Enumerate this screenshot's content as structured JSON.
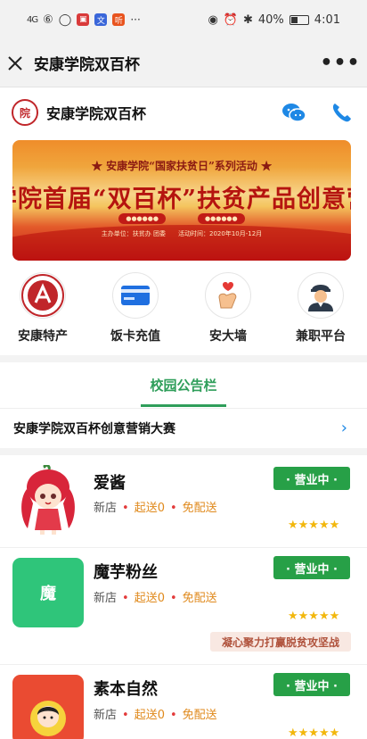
{
  "status_bar": {
    "signal": "4G",
    "battery": "40%",
    "time": "4:01"
  },
  "title_bar": {
    "title": "安康学院双百杯",
    "more": "•••"
  },
  "shop_header": {
    "logo_text": "院",
    "name": "安康学院双百杯"
  },
  "banner": {
    "subtitle": "★ 安康学院“国家扶贫日”系列活动 ★",
    "headline": "学院首届“双百杯”扶贫产品创意营销",
    "pills": [
      "●●●●●●",
      "●●●●●●"
    ],
    "footer": "主办单位：扶贫办 团委　　活动时间：2020年10月-12月"
  },
  "quick_menu": [
    {
      "label": "安康特产",
      "icon": "school-logo-icon"
    },
    {
      "label": "饭卡充值",
      "icon": "card-icon"
    },
    {
      "label": "安大墙",
      "icon": "heart-hand-icon"
    },
    {
      "label": "兼职平台",
      "icon": "worker-icon"
    }
  ],
  "notice": {
    "tab": "校园公告栏",
    "text": "安康学院双百杯创意营销大赛"
  },
  "shops": [
    {
      "name": "爱酱",
      "tag_new": "新店",
      "tag_min": "起送0",
      "tag_fee": "免配送",
      "status": "· 营业中 ·",
      "rating": 5
    },
    {
      "name": "魔芋粉丝",
      "thumb_text": "魔",
      "tag_new": "新店",
      "tag_min": "起送0",
      "tag_fee": "免配送",
      "status": "· 营业中 ·",
      "rating": 5,
      "slogan": "凝心聚力打赢脱贫攻坚战"
    },
    {
      "name": "素本自然",
      "tag_new": "新店",
      "tag_min": "起送0",
      "tag_fee": "免配送",
      "status": "· 营业中 ·",
      "rating": 5
    }
  ],
  "colors": {
    "accent_green": "#27a047",
    "notice_green": "#2f9e5a",
    "link_blue": "#1e88e5",
    "star": "#f2b70c",
    "fee_orange": "#e08a1d"
  }
}
